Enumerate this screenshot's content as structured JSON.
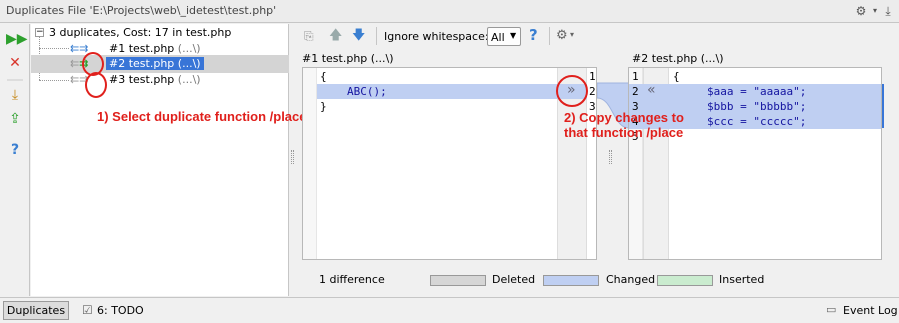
{
  "window": {
    "title": "Duplicates File 'E:\\Projects\\web\\_idetest\\test.php'",
    "settings_icon": "gear-icon",
    "hide_icon": "hide-down-icon"
  },
  "left_toolbar": {
    "icons": [
      "rerun-icon",
      "close-icon",
      "export-icon",
      "export-to-file-icon",
      "help-icon"
    ]
  },
  "tree": {
    "root_label": "3 duplicates, Cost: 17 in test.php",
    "items": [
      {
        "label": "#1 test.php",
        "hint": "(...\\)",
        "selected": false
      },
      {
        "label": "#2 test.php",
        "hint": "(...\\)",
        "selected": true
      },
      {
        "label": "#3 test.php",
        "hint": "(...\\)",
        "selected": false
      }
    ]
  },
  "annotations": {
    "step1": "1) Select duplicate function /place",
    "step2_line1": "2) Copy changes to",
    "step2_line2": "that function /place"
  },
  "diff_toolbar": {
    "ignore_whitespace_label": "Ignore whitespace:",
    "ignore_whitespace_value": "All",
    "help": "?"
  },
  "left_pane": {
    "header": "#1 test.php (...\\)",
    "lines": [
      "{",
      "ABC();",
      "}"
    ]
  },
  "right_pane": {
    "header": "#2 test.php (...\\)",
    "lines": [
      "{",
      "$aaa = \"aaaaa\";",
      "$bbb = \"bbbbb\";",
      "$ccc = \"ccccc\";"
    ],
    "line_numbers": [
      "1",
      "2",
      "3",
      "4",
      "5"
    ]
  },
  "middle_gutter": {
    "line_numbers": [
      "1",
      "2",
      "3"
    ],
    "copy_right_glyph": "»",
    "copy_left_glyph": "«"
  },
  "legend": {
    "summary": "1 difference",
    "deleted": "Deleted",
    "changed": "Changed",
    "inserted": "Inserted",
    "colors": {
      "deleted": "#d6d6d6",
      "changed": "#bfcff2",
      "inserted": "#caeccf"
    }
  },
  "bottom_bar": {
    "duplicates_tab": "Duplicates",
    "todo_tab": "6: TODO",
    "event_log": "Event Log"
  }
}
